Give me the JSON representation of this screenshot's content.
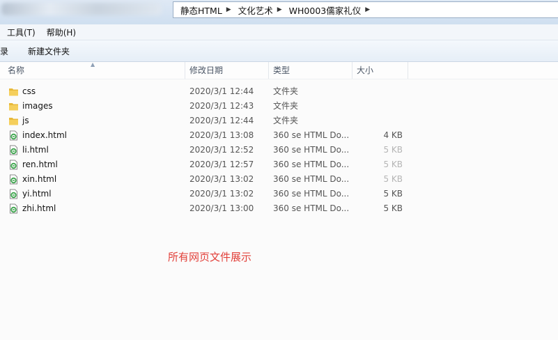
{
  "address": {
    "crumbs": [
      "静态HTML",
      "文化艺术",
      "WH0003儒家礼仪"
    ]
  },
  "menu": {
    "tools": "工具(T)",
    "help": "帮助(H)"
  },
  "toolbar": {
    "partial": "录",
    "new_folder": "新建文件夹"
  },
  "columns": {
    "name": "名称",
    "modified": "修改日期",
    "type": "类型",
    "size": "大小"
  },
  "files": [
    {
      "name": "css",
      "date": "2020/3/1 12:44",
      "type": "文件夹",
      "size": "",
      "kind": "folder-icon"
    },
    {
      "name": "images",
      "date": "2020/3/1 12:43",
      "type": "文件夹",
      "size": "",
      "kind": "folder-icon"
    },
    {
      "name": "js",
      "date": "2020/3/1 12:44",
      "type": "文件夹",
      "size": "",
      "kind": "folder-icon"
    },
    {
      "name": "index.html",
      "date": "2020/3/1 13:08",
      "type": "360 se HTML Do...",
      "size": "4 KB",
      "kind": "html-file-icon"
    },
    {
      "name": "li.html",
      "date": "2020/3/1 12:52",
      "type": "360 se HTML Do...",
      "size": "5 KB",
      "kind": "html-file-icon"
    },
    {
      "name": "ren.html",
      "date": "2020/3/1 12:57",
      "type": "360 se HTML Do...",
      "size": "5 KB",
      "kind": "html-file-icon"
    },
    {
      "name": "xin.html",
      "date": "2020/3/1 13:02",
      "type": "360 se HTML Do...",
      "size": "5 KB",
      "kind": "html-file-icon"
    },
    {
      "name": "yi.html",
      "date": "2020/3/1 13:02",
      "type": "360 se HTML Do...",
      "size": "5 KB",
      "kind": "html-file-icon"
    },
    {
      "name": "zhi.html",
      "date": "2020/3/1 13:00",
      "type": "360 se HTML Do...",
      "size": "5 KB",
      "kind": "html-file-icon"
    }
  ],
  "caption": "所有网页文件展示",
  "colors": {
    "folder": "#e8b93a",
    "html_icon_green": "#3aa34a",
    "caption": "#e2403a"
  }
}
